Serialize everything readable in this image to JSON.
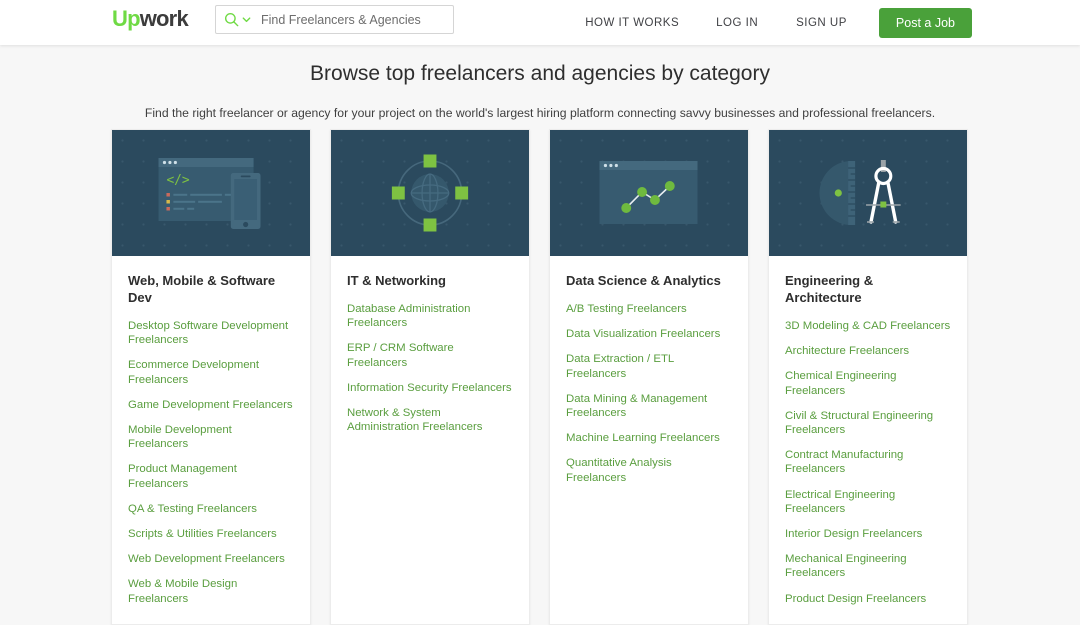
{
  "header": {
    "logo_up": "Up",
    "logo_work": "work",
    "search": {
      "placeholder": "Find Freelancers & Agencies",
      "value": "",
      "search_icon": "search-icon",
      "chevron_icon": "chevron-down-icon"
    },
    "nav": {
      "how_it_works": "HOW IT WORKS",
      "log_in": "LOG IN",
      "sign_up": "SIGN UP",
      "post_a_job": "Post a Job"
    }
  },
  "hero": {
    "title": "Browse top freelancers and agencies by category",
    "subtitle": "Find the right freelancer or agency for your project on the world's largest hiring platform connecting savvy businesses and professional freelancers."
  },
  "colors": {
    "brand_green": "#6fda44",
    "link_green": "#5a9e3f",
    "button_green": "#4aa13a",
    "thumb_dark": "#2b4a5e",
    "page_background": "#f7f7f7",
    "accent_green_light": "#7ec242"
  },
  "cards": [
    {
      "title": "Web, Mobile & Software Dev",
      "illustration": "code-window-and-phone-illustration",
      "links": [
        "Desktop Software Development Freelancers",
        "Ecommerce Development Freelancers",
        "Game Development Freelancers",
        "Mobile Development Freelancers",
        "Product Management Freelancers",
        "QA & Testing Freelancers",
        "Scripts & Utilities Freelancers",
        "Web Development Freelancers",
        "Web & Mobile Design Freelancers"
      ]
    },
    {
      "title": "IT & Networking",
      "illustration": "globe-network-nodes-illustration",
      "links": [
        "Database Administration Freelancers",
        "ERP / CRM Software Freelancers",
        "Information Security Freelancers",
        "Network & System Administration Freelancers"
      ]
    },
    {
      "title": "Data Science & Analytics",
      "illustration": "line-chart-window-illustration",
      "links": [
        "A/B Testing Freelancers",
        "Data Visualization Freelancers",
        "Data Extraction / ETL Freelancers",
        "Data Mining & Management Freelancers",
        "Machine Learning Freelancers",
        "Quantitative Analysis Freelancers"
      ]
    },
    {
      "title": "Engineering & Architecture",
      "illustration": "protractor-and-compass-illustration",
      "links": [
        "3D Modeling & CAD Freelancers",
        "Architecture Freelancers",
        "Chemical Engineering Freelancers",
        "Civil & Structural Engineering Freelancers",
        "Contract Manufacturing Freelancers",
        "Electrical Engineering Freelancers",
        "Interior Design Freelancers",
        "Mechanical Engineering Freelancers",
        "Product Design Freelancers"
      ]
    }
  ]
}
